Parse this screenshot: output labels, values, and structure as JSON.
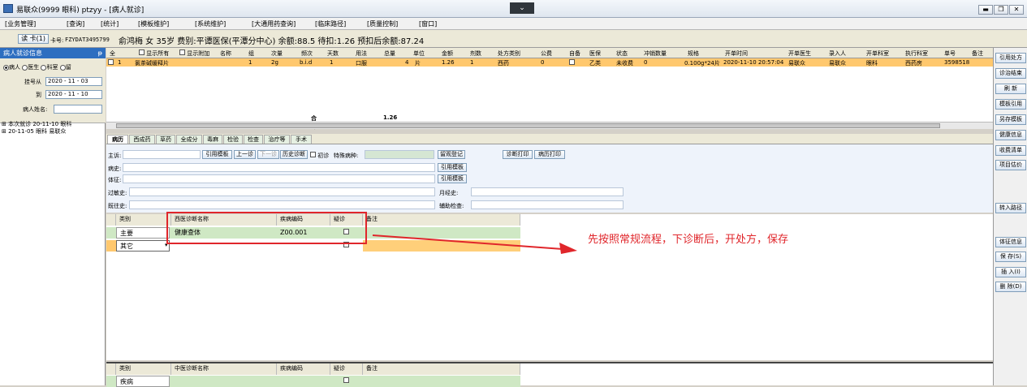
{
  "window": {
    "title": "易联众(9999 眼科) ptzyy - [病人就诊]"
  },
  "menu": [
    "[业务管理]",
    "[查询]",
    "[统计]",
    "[模板维护]",
    "[系统维护]",
    "[大通用药查询]",
    "[临床路径]",
    "[质量控制]",
    "[窗口]"
  ],
  "patient": {
    "read_card": "读 卡(1)",
    "card_label": "卡号:",
    "card_no": "FZYDAT3495799",
    "info": "俞鸿梅 女 35岁 费别:平谭医保(平潭分中心) 余额:88.5 待扣:1.26 预扣后余额:87.24"
  },
  "left": {
    "header": "病人就诊信息",
    "pin": "ᵽ",
    "radios": [
      "病人",
      "医生",
      "科室",
      "留"
    ],
    "reg_from_label": "挂号从",
    "reg_from": "2020 - 11 - 03",
    "reg_to_label": "到",
    "reg_to": "2020 - 11 - 10",
    "name_label": "病人姓名:",
    "tree": [
      "本次就诊 20-11-10 眼科",
      "20-11-05 眼科 易联众"
    ]
  },
  "grid": {
    "all_label": "全",
    "show_all": "显示所有",
    "show_attach": "显示附加",
    "headers": [
      "名称",
      "组",
      "次量",
      "频次",
      "天数",
      "用法",
      "总量",
      "单位",
      "金额",
      "剂数",
      "处方类别",
      "公费",
      "自备",
      "医保",
      "状态",
      "冲销数量",
      "规格",
      "开单时间",
      "开单医生",
      "录入人",
      "开单科室",
      "执行科室",
      "单号",
      "备注"
    ],
    "row": {
      "no": "1",
      "name": "氯茶碱缓释片",
      "group": "1",
      "dose": "2g",
      "freq": "b.i.d",
      "days": "1",
      "usage": "口服",
      "total": "4",
      "unit": "片",
      "amount": "1.26",
      "count": "1",
      "rx_type": "西药",
      "public": "0",
      "insurance": "乙类",
      "status": "未收费",
      "refund": "0",
      "spec": "0.100g*24片",
      "time": "2020-11-10 20:57:04",
      "doctor": "易联众",
      "entry": "易联众",
      "dept": "眼科",
      "exec": "西药房",
      "order_no": "3598518"
    },
    "sum_label": "合计:",
    "sum_value": "1.26"
  },
  "tabs": [
    "病历",
    "西成药",
    "草药",
    "全成分",
    "毒麻",
    "检验",
    "检查",
    "治疗等",
    "手术"
  ],
  "emr": {
    "complaint": "主诉:",
    "btn_template": "引用模板",
    "btn_prev": "上一诊",
    "btn_next": "下一诊",
    "btn_history": "历史诊断",
    "first_visit": "初诊",
    "special": "特殊病种:",
    "btn_leave": "留观登记",
    "btn_diag_print": "诊断打印",
    "btn_emr_print": "病历打印",
    "history": "病史:",
    "signs": "体征:",
    "allergy": "过敏史:",
    "past": "既往史:",
    "btn_ref1": "引用模板",
    "btn_ref2": "引用模板",
    "menstrual": "月经史:",
    "aux": "辅助检查:"
  },
  "diag": {
    "headers": [
      "类别",
      "西医诊断名称",
      "疾病编码",
      "疑诊",
      "备注"
    ],
    "rows": [
      {
        "type": "主要",
        "name": "健康查体",
        "code": "Z00.001"
      },
      {
        "type": "其它",
        "name": "",
        "code": ""
      }
    ]
  },
  "diag2": {
    "headers": [
      "类别",
      "中医诊断名称",
      "疾病编码",
      "疑诊",
      "备注"
    ],
    "row_type": "疾病"
  },
  "right_buttons": [
    "引用处方",
    "诊治结束",
    "刷 新",
    "模板引用",
    "另存模板",
    "健康信息",
    "收费清单",
    "项目估价",
    "转入路径",
    "体征信息",
    "保 存(S)",
    "插 入(I)",
    "删 除(D)"
  ],
  "annotation": "先按照常规流程，下诊断后，开处方，保存",
  "colors": {
    "accent": "#e0262b",
    "row": "#ffc86e",
    "tab": "#e6f0e2"
  }
}
